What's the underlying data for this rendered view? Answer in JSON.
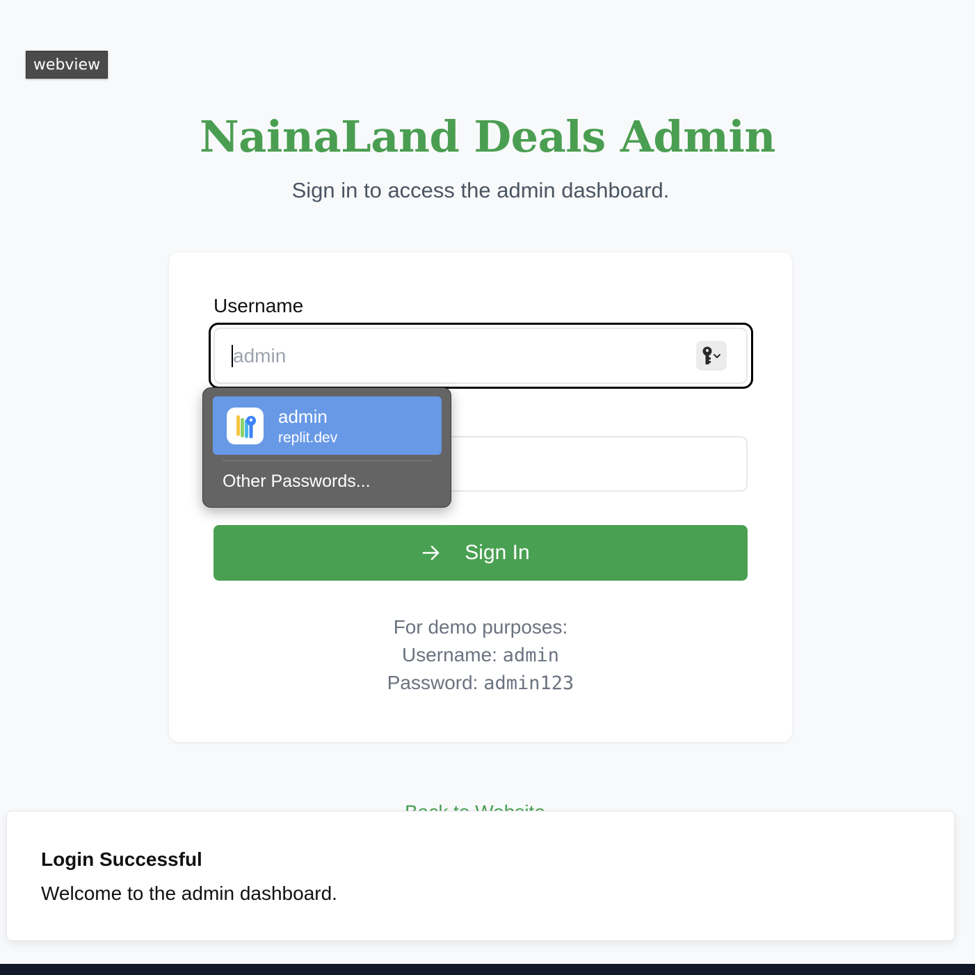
{
  "webview_label": "webview",
  "header": {
    "title": "NainaLand Deals Admin",
    "subtitle": "Sign in to access the admin dashboard."
  },
  "form": {
    "username_label": "Username",
    "username_placeholder": "admin",
    "sign_in_label": "Sign In"
  },
  "autofill": {
    "account_user": "admin",
    "account_site": "replit.dev",
    "other_passwords": "Other Passwords..."
  },
  "demo": {
    "intro": "For demo purposes:",
    "username_prefix": "Username: ",
    "username_value": "admin",
    "password_prefix": "Password: ",
    "password_value": "admin123"
  },
  "back_link": "Back to Website",
  "toast": {
    "title": "Login Successful",
    "description": "Welcome to the admin dashboard."
  },
  "colors": {
    "brand_green": "#4aa052",
    "autofill_highlight": "#6899e6",
    "bottom_bar": "#111827"
  },
  "icons": [
    "arrow-right-icon",
    "key-icon",
    "chevron-down-icon",
    "passwords-app-icon"
  ]
}
